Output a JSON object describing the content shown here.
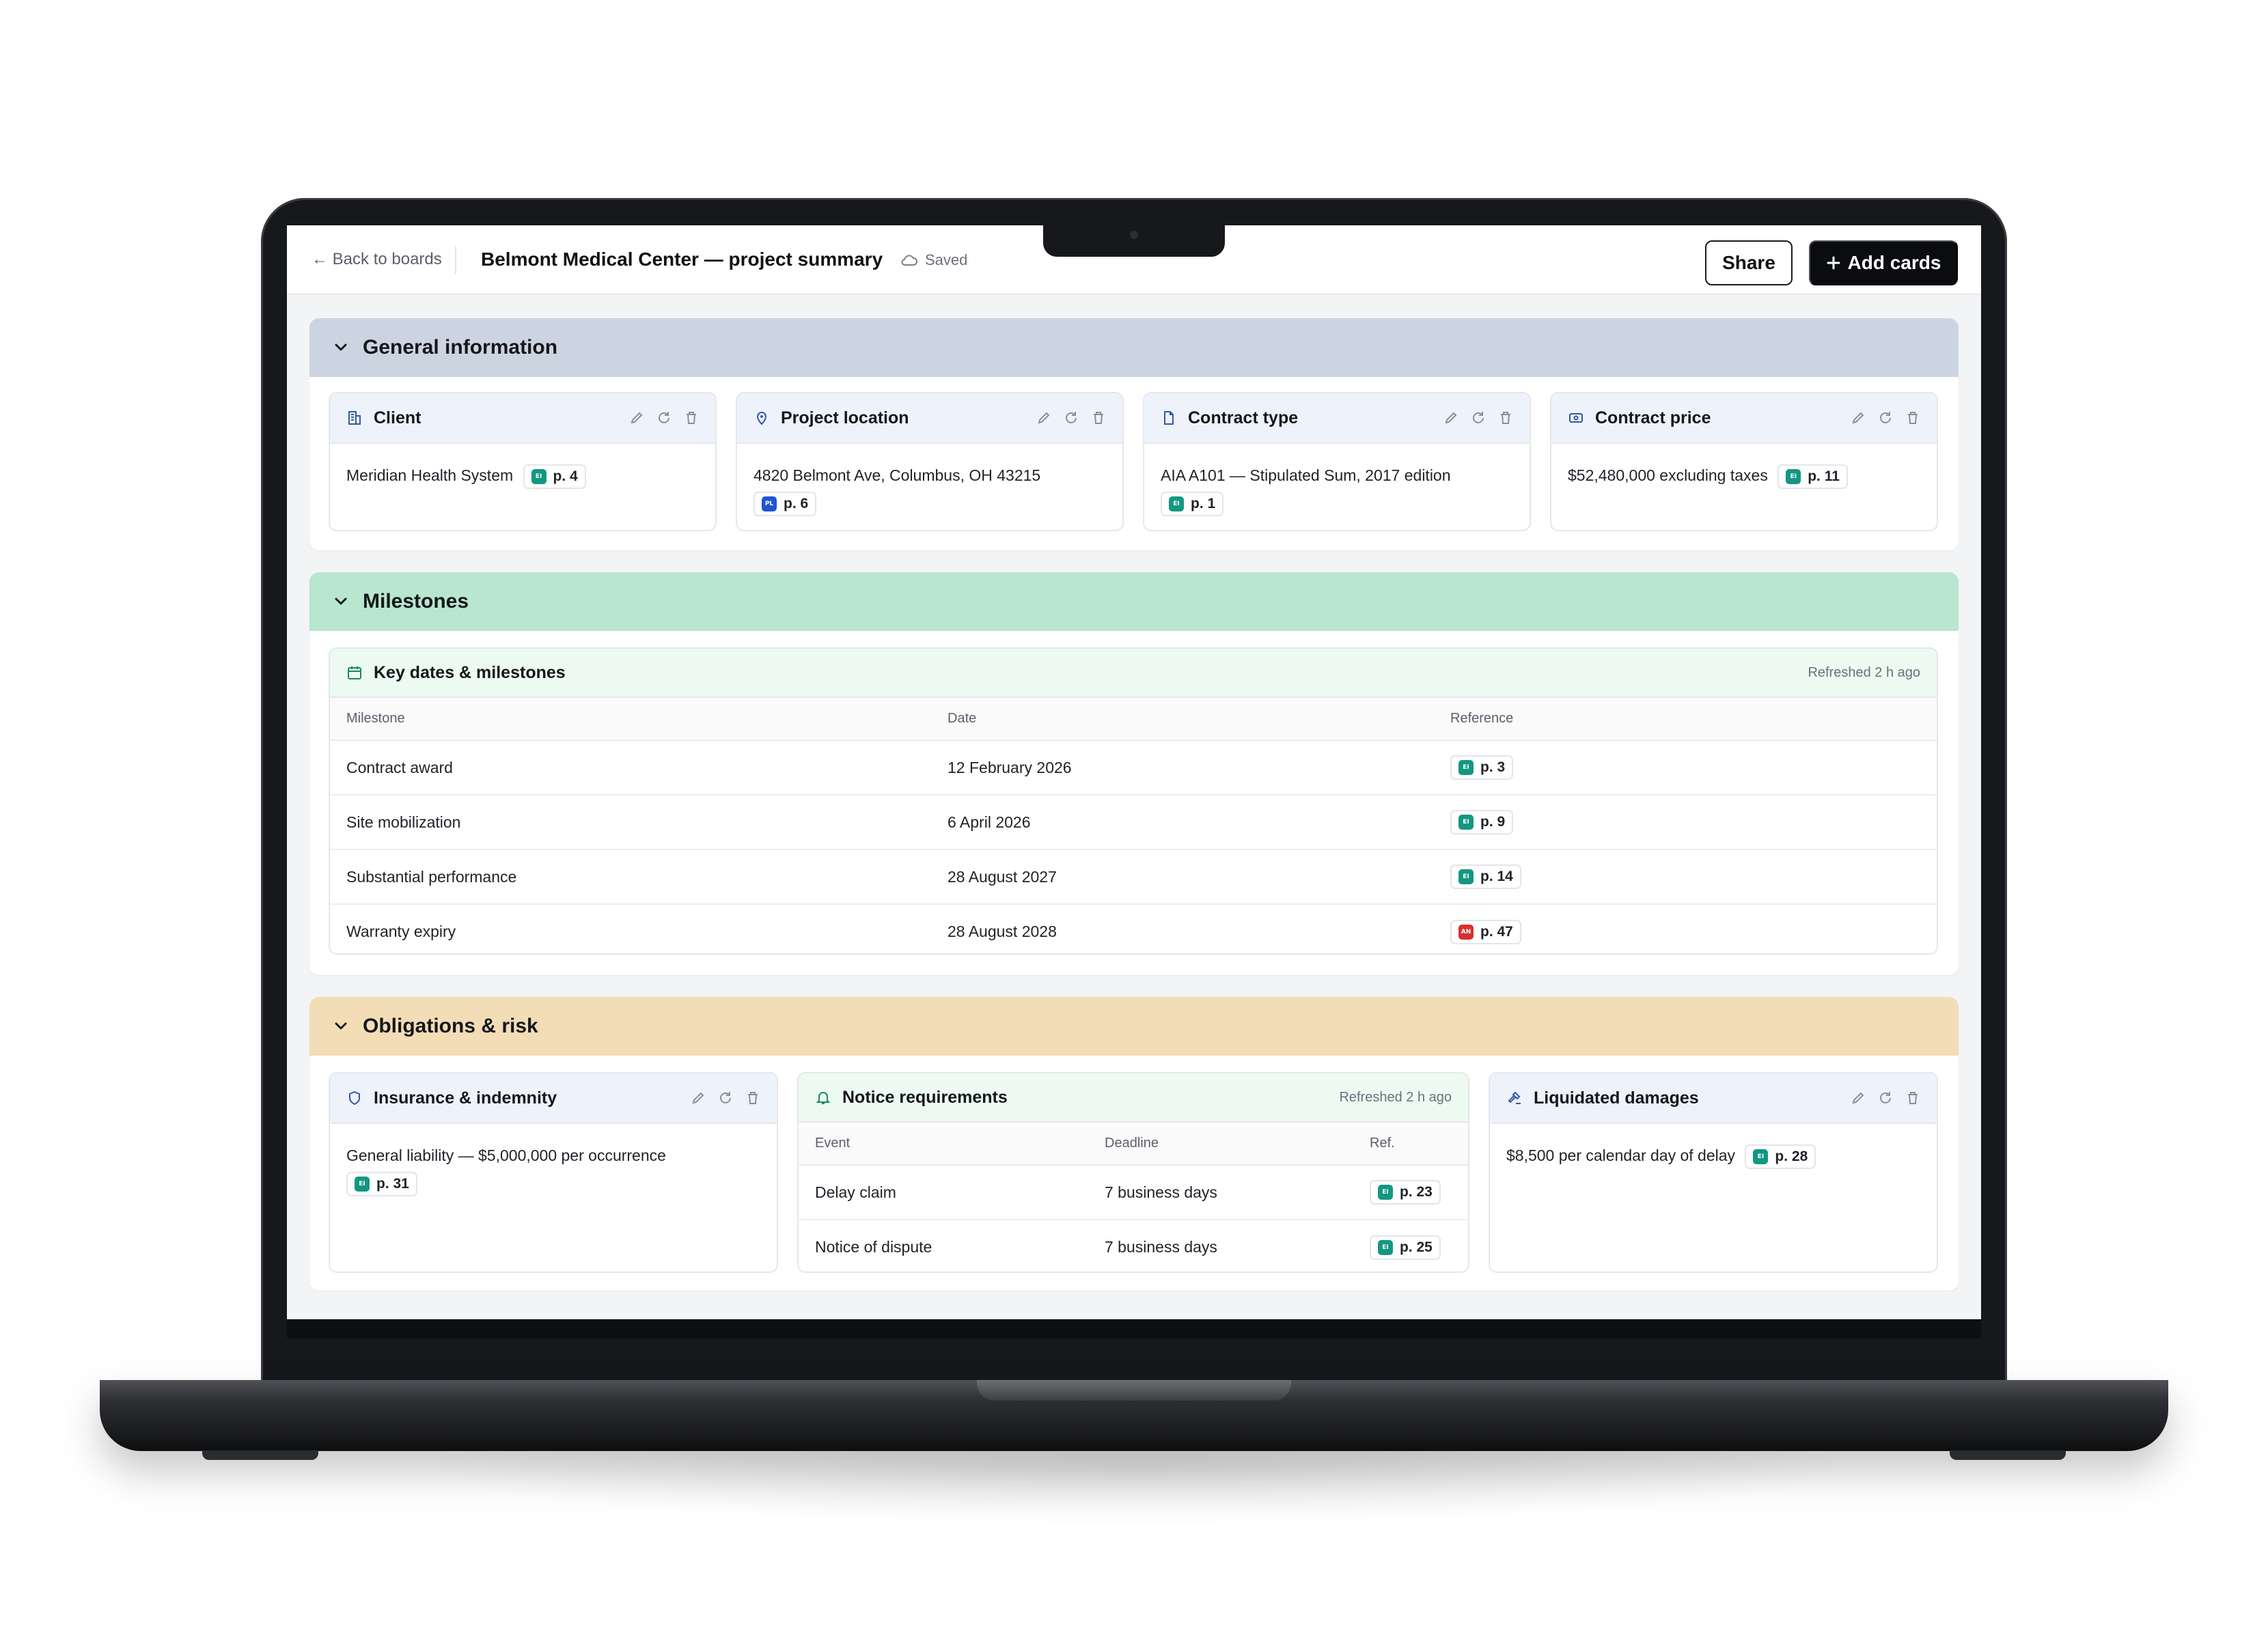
{
  "topbar": {
    "back_label": "← Back to boards",
    "title": "Belmont Medical Center — project summary",
    "saved_label": "Saved",
    "share_label": "Share",
    "add_cards_label": "Add cards"
  },
  "colors": {
    "general_header": "#cdd4e1",
    "milestones_header": "#b9e6cf",
    "obligations_header": "#f3ddb7",
    "source_ei": "#149782",
    "source_pl": "#1e54d6",
    "source_an": "#d63131"
  },
  "sections": {
    "general": {
      "title": "General information",
      "cards": [
        {
          "title": "Client",
          "icon": "building-icon",
          "value": "Meridian Health System",
          "ref": {
            "tag": "EI",
            "page": "p. 4"
          }
        },
        {
          "title": "Project location",
          "icon": "map-pin-icon",
          "value": "4820 Belmont Ave, Columbus, OH 43215",
          "ref": {
            "tag": "PL",
            "page": "p. 6"
          }
        },
        {
          "title": "Contract type",
          "icon": "document-icon",
          "value": "AIA A101 — Stipulated Sum, 2017 edition",
          "ref": {
            "tag": "EI",
            "page": "p. 1"
          }
        },
        {
          "title": "Contract price",
          "icon": "banknote-icon",
          "value": "$52,480,000 excluding taxes",
          "ref": {
            "tag": "EI",
            "page": "p. 11"
          }
        }
      ]
    },
    "milestones": {
      "title": "Milestones",
      "card_title": "Key dates & milestones",
      "refreshed": "Refreshed 2 h ago",
      "columns": [
        "Milestone",
        "Date",
        "Reference"
      ],
      "rows": [
        {
          "milestone": "Contract award",
          "date": "12 February 2026",
          "tag": "EI",
          "page": "p. 3"
        },
        {
          "milestone": "Site mobilization",
          "date": "6 April 2026",
          "tag": "EI",
          "page": "p. 9"
        },
        {
          "milestone": "Substantial performance",
          "date": "28 August 2027",
          "tag": "EI",
          "page": "p. 14"
        },
        {
          "milestone": "Warranty expiry",
          "date": "28 August 2028",
          "tag": "AN",
          "page": "p. 47"
        }
      ]
    },
    "obligations": {
      "title": "Obligations & risk",
      "insurance": {
        "title": "Insurance & indemnity",
        "value": "General liability — $5,000,000 per occurrence",
        "tag": "EI",
        "page": "p. 31"
      },
      "notice": {
        "title": "Notice requirements",
        "refreshed": "Refreshed 2 h ago",
        "columns": [
          "Event",
          "Deadline",
          "Ref."
        ],
        "rows": [
          {
            "event": "Delay claim",
            "deadline": "7 business days",
            "tag": "EI",
            "page": "p. 23"
          },
          {
            "event": "Notice of dispute",
            "deadline": "7 business days",
            "tag": "EI",
            "page": "p. 25"
          }
        ]
      },
      "damages": {
        "title": "Liquidated damages",
        "value": "$8,500 per calendar day of delay",
        "tag": "EI",
        "page": "p. 28"
      }
    }
  }
}
